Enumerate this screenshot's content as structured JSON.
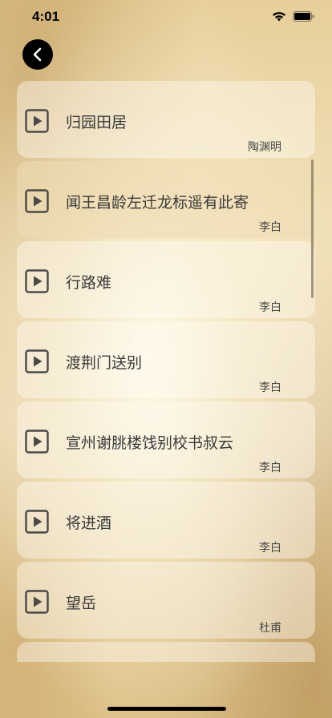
{
  "status_bar": {
    "time": "4:01"
  },
  "poems": [
    {
      "title": "归园田居",
      "author": "陶渊明"
    },
    {
      "title": "闻王昌龄左迁龙标遥有此寄",
      "author": "李白"
    },
    {
      "title": "行路难",
      "author": "李白"
    },
    {
      "title": "渡荆门送别",
      "author": "李白"
    },
    {
      "title": "宣州谢朓楼饯别校书叔云",
      "author": "李白"
    },
    {
      "title": "将进酒",
      "author": "李白"
    },
    {
      "title": "望岳",
      "author": "杜甫"
    },
    {
      "title": "",
      "author": ""
    }
  ],
  "icons": {
    "back": "chevron-left-icon",
    "play": "play-icon",
    "wifi": "wifi-icon",
    "battery": "battery-icon"
  }
}
